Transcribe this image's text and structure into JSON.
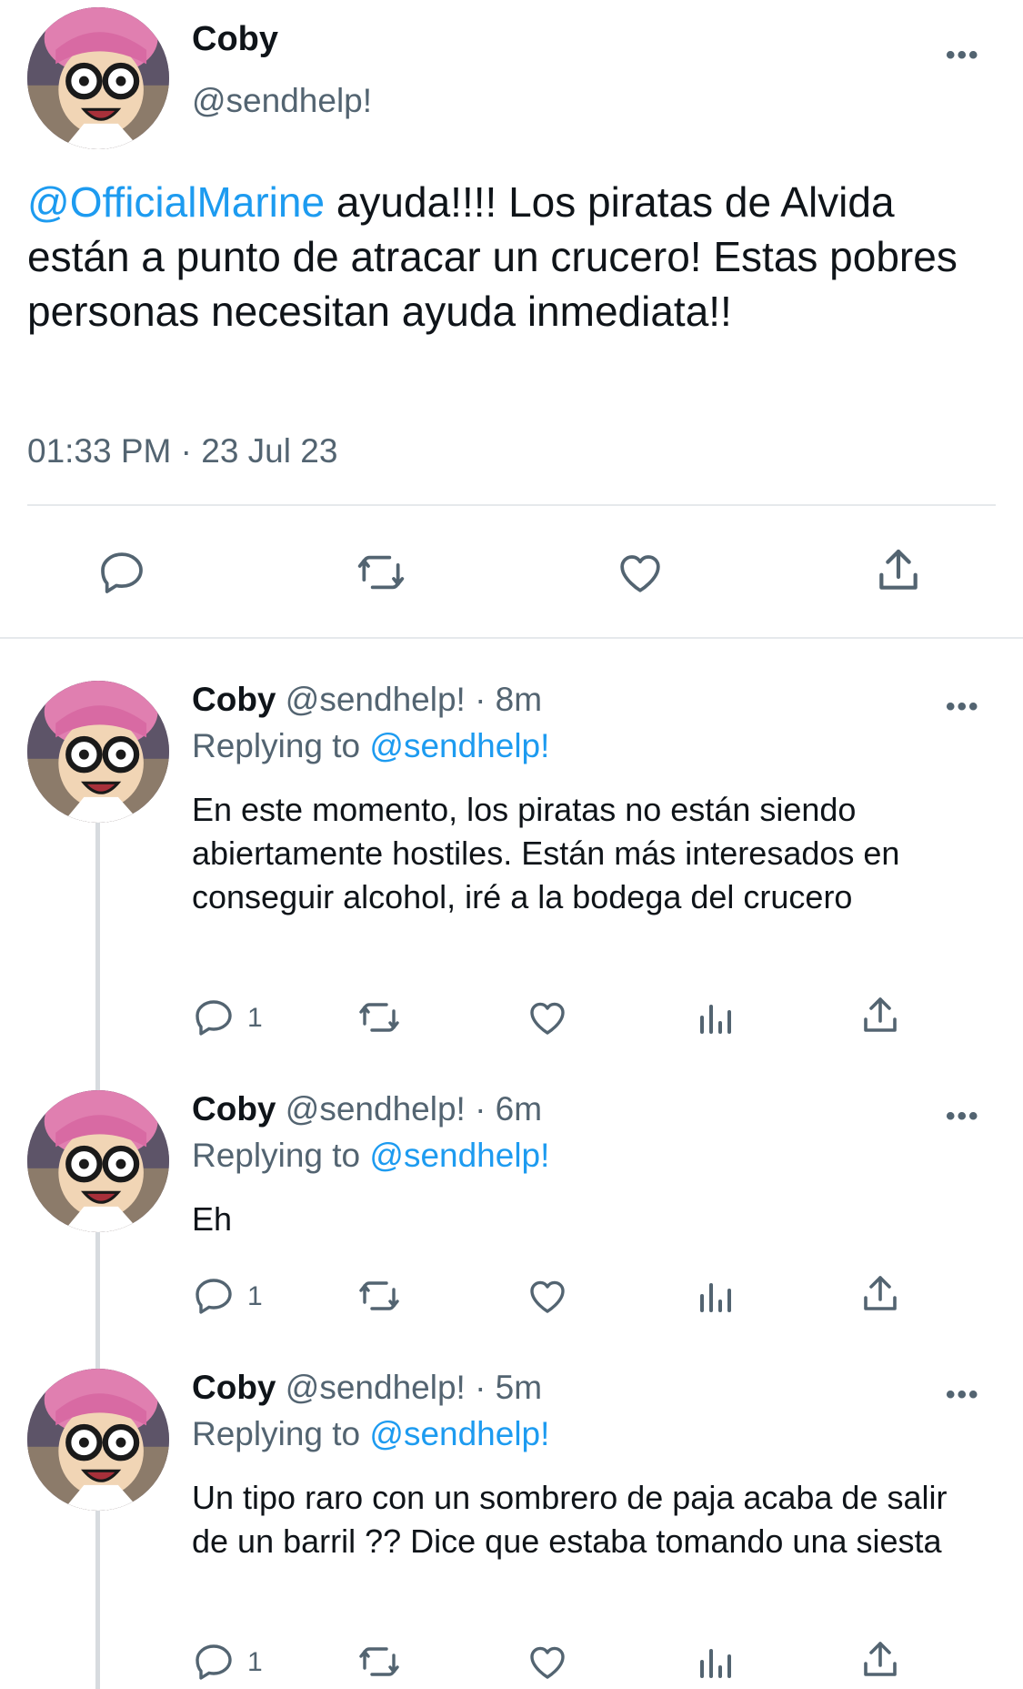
{
  "colors": {
    "accent": "#1d9bf0",
    "muted": "#536471",
    "text": "#0f1419",
    "divider": "#e6e9ec"
  },
  "main_tweet": {
    "name": "Coby",
    "handle": "@sendhelp!",
    "more_label": "•••",
    "mention": "@OfficialMarine",
    "text": " ayuda!!!! Los piratas de Alvida están a punto de atracar un crucero! Estas pobres personas necesitan ayuda inmediata!!",
    "timestamp": "01:33 PM · 23 Jul 23",
    "actions": [
      "reply-icon",
      "retweet-icon",
      "like-icon",
      "share-icon"
    ]
  },
  "replies": [
    {
      "name": "Coby",
      "meta": " @sendhelp! · 8m",
      "replying_prefix": "Replying to ",
      "replying_handle": "@sendhelp!",
      "text": "En este momento, los piratas no están siendo abiertamente hostiles. Están más interesados en conseguir alcohol, iré a la bodega del crucero",
      "reply_count": "1",
      "more_label": "•••"
    },
    {
      "name": "Coby",
      "meta": " @sendhelp! · 6m",
      "replying_prefix": "Replying to ",
      "replying_handle": "@sendhelp!",
      "text": "Eh",
      "reply_count": "1",
      "more_label": "•••"
    },
    {
      "name": "Coby",
      "meta": " @sendhelp! · 5m",
      "replying_prefix": "Replying to ",
      "replying_handle": "@sendhelp!",
      "text": "Un tipo raro con un sombrero de paja acaba de salir de un barril ?? Dice que estaba tomando una siesta",
      "reply_count": "1",
      "more_label": "•••"
    }
  ]
}
